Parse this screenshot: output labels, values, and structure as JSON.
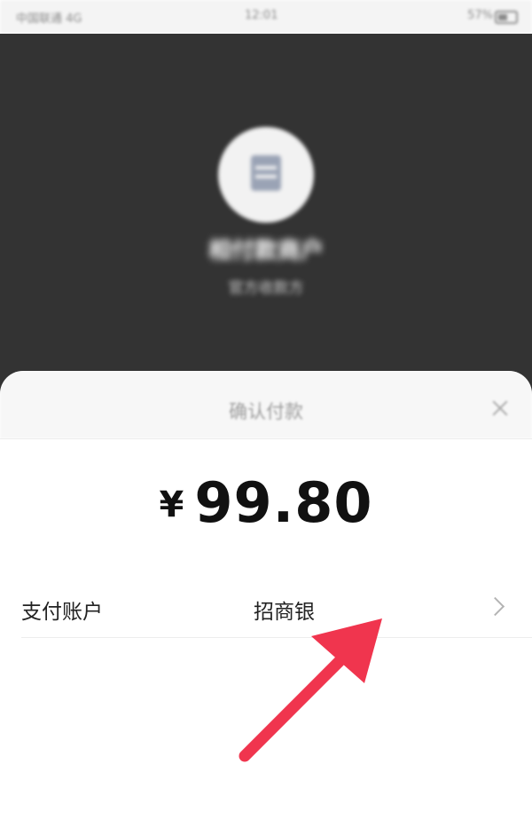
{
  "status_bar": {
    "carrier": "中国联通 4G",
    "time": "12:01",
    "battery": "57%"
  },
  "merchant": {
    "logo_icon": "merchant-logo-icon",
    "name": "相付款商户",
    "subtitle": "官方收款方"
  },
  "payment_sheet": {
    "title": "确认付款",
    "close_icon": "close-icon",
    "currency_symbol": "¥",
    "amount": "99.80",
    "account_row": {
      "label": "支付账户",
      "value": "招商银",
      "chevron_icon": "chevron-right-icon"
    }
  },
  "annotation": {
    "arrow_color": "#f0354e",
    "arrow_icon": "red-arrow"
  }
}
